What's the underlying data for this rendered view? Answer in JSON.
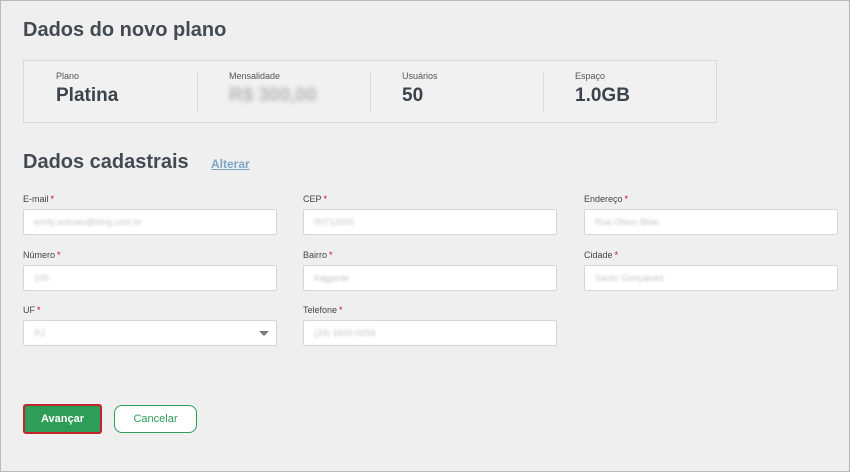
{
  "plan_section": {
    "title": "Dados do novo plano",
    "columns": [
      {
        "label": "Plano",
        "value": "Platina"
      },
      {
        "label": "Mensalidade",
        "value": "R$ 300,00"
      },
      {
        "label": "Usuários",
        "value": "50"
      },
      {
        "label": "Espaço",
        "value": "1.0GB"
      }
    ]
  },
  "register_section": {
    "title": "Dados cadastrais",
    "edit_link": "Alterar",
    "required_marker": "*",
    "fields": {
      "email": {
        "label": "E-mail",
        "value": "emily.solman@bing.com.br"
      },
      "cep": {
        "label": "CEP",
        "value": "00712000"
      },
      "endereco": {
        "label": "Endereço",
        "value": "Rua Olavo Bilac"
      },
      "numero": {
        "label": "Número",
        "value": "100"
      },
      "bairro": {
        "label": "Bairro",
        "value": "Irajgante"
      },
      "cidade": {
        "label": "Cidade",
        "value": "Santo Gonçalves"
      },
      "uf": {
        "label": "UF",
        "value": "RJ"
      },
      "telefone": {
        "label": "Telefone",
        "value": "(24) 3449-0294"
      }
    }
  },
  "actions": {
    "primary": "Avançar",
    "secondary": "Cancelar"
  },
  "colors": {
    "accent_green": "#2e9d57",
    "focus_red": "#c0262b",
    "link_blue": "#7aa6c8"
  }
}
